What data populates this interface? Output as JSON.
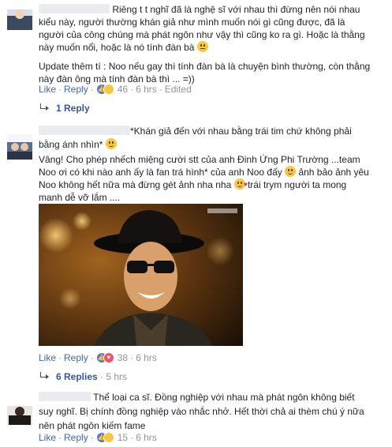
{
  "comments": [
    {
      "text_lines": [
        "Riêng t t nghĩ đã là nghệ sĩ với nhau thì đừng nên nói nhau",
        "kiểu này, người thường khán giả như mình muốn nói gì cũng được, đã là",
        "người của công chúng mà phát ngôn như vậy thì cũng ko ra gì. Hoặc là thằng",
        "này muốn nổi, hoặc là nó tính đàn bà"
      ],
      "update_lines": [
        "Update thêm tí : Noo nếu gay thì tính đàn bà là chuyện bình thường, còn thằng",
        "này đàn ông mà tính đàn bà thì ... =))"
      ],
      "actions": {
        "like": "Like",
        "reply": "Reply",
        "reaction_count": "46",
        "time": "6 hrs",
        "edited": "Edited"
      },
      "replies_label": "1 Reply"
    },
    {
      "text_lines": [
        "*Khán giả đến với nhau bằng trái tim chứ không phải",
        "bằng ánh nhìn*",
        "Vâng! Cho phép nhếch miệng cười stt của anh Đinh Ứng Phi Trường ...team",
        "Noo ơi có khi nào anh ấy là fan trá hình* của anh Noo đấy",
        "ảnh bảo ảnh yêu",
        "Noo không hết nữa mà đừng gét ảnh nha nha",
        "trái trym người ta mong",
        "manh dễ vỡ lắm ...."
      ],
      "actions": {
        "like": "Like",
        "reply": "Reply",
        "reaction_count": "38",
        "time": "6 hrs"
      },
      "replies_label": "6 Replies",
      "replies_time": "5 hrs"
    },
    {
      "text_lines": [
        "Thể loại ca sĩ. Đồng nghiệp với nhau mà phát ngôn không biết",
        "suy nghĩ. Bị chính đồng nghiệp vào nhắc nhở. Hết thời chả ai thèm chú ý nữa",
        "nên phát ngôn kiếm fame"
      ],
      "actions": {
        "like": "Like",
        "reply": "Reply",
        "reaction_count": "15",
        "time": "6 hrs"
      }
    }
  ],
  "colors": {
    "link": "#4267b2",
    "author": "#365899",
    "meta": "#90949c",
    "text": "#1d2129"
  }
}
